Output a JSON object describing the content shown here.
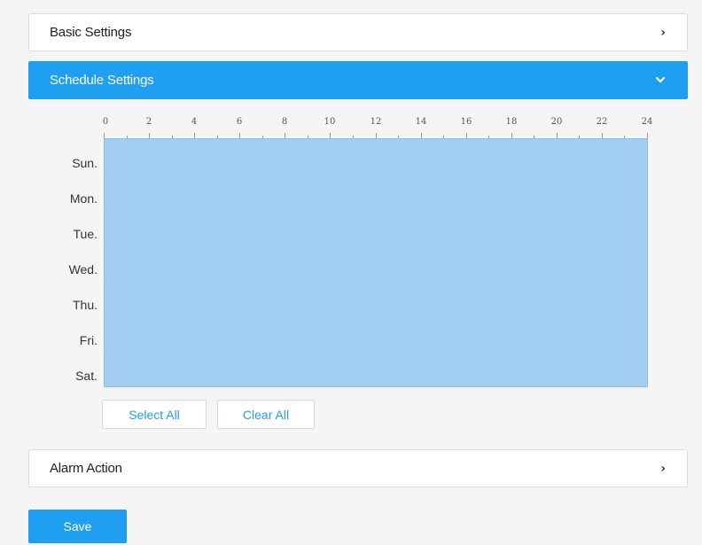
{
  "sections": {
    "basic": {
      "title": "Basic Settings",
      "icon": "chevron-right-icon",
      "chevron": "›"
    },
    "schedule": {
      "title": "Schedule Settings",
      "icon": "chevron-down-icon",
      "chevron": "⌄"
    },
    "alarm": {
      "title": "Alarm Action",
      "icon": "chevron-right-icon",
      "chevron": "›"
    }
  },
  "schedule": {
    "hour_labels": [
      "0",
      "2",
      "4",
      "6",
      "8",
      "10",
      "12",
      "14",
      "16",
      "18",
      "20",
      "22",
      "24"
    ],
    "days": [
      "Sun.",
      "Mon.",
      "Tue.",
      "Wed.",
      "Thu.",
      "Fri.",
      "Sat."
    ],
    "select_all_label": "Select All",
    "clear_all_label": "Clear All",
    "selected_color": "#a2cef1"
  },
  "actions": {
    "save_label": "Save"
  },
  "colors": {
    "accent": "#1e9ff2",
    "background": "#f5f5f5"
  }
}
